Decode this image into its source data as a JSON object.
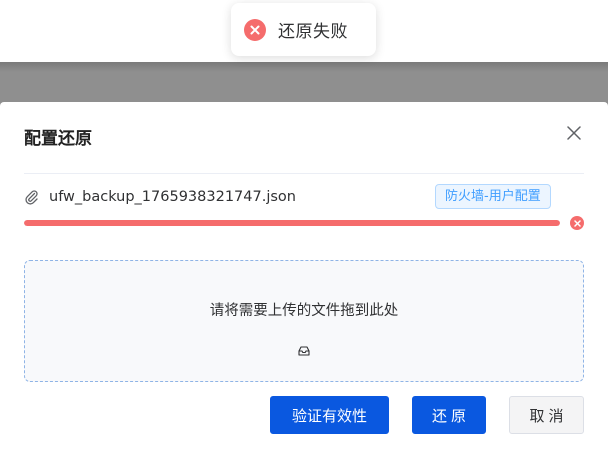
{
  "toast": {
    "message": "还原失败",
    "icon": "error-circle-icon",
    "color": "#f56c6c"
  },
  "dialog": {
    "title": "配置还原",
    "close_icon": "close-icon",
    "file": {
      "name": "ufw_backup_1765938321747.json",
      "icon": "paperclip-icon",
      "tag": "防火墙-用户配置",
      "progress": 1.0,
      "status": "error",
      "status_color": "#f56c6c"
    },
    "dropzone": {
      "text": "请将需要上传的文件拖到此处",
      "icon": "inbox-icon"
    },
    "buttons": {
      "validate_label": "验证有效性",
      "restore_label": "还原",
      "cancel_label": "取消"
    },
    "colors": {
      "primary": "#0a58e0",
      "tag_text": "#409eff"
    }
  }
}
